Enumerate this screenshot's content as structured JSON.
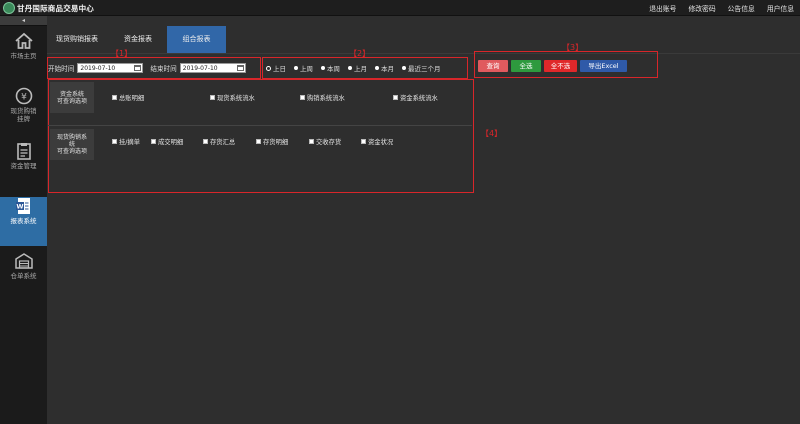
{
  "header": {
    "logo_text": "甘丹国际商品交易中心",
    "links": [
      "退出账号",
      "修改密码",
      "公告信息",
      "用户信息"
    ]
  },
  "sidebar": {
    "collapse_glyph": "◂",
    "items": [
      {
        "label": "市场主页",
        "icon": "home-icon"
      },
      {
        "label": "现货购销",
        "label2": "挂牌",
        "icon": "yen-icon"
      },
      {
        "label": "资金管理",
        "icon": "clipboard-icon"
      },
      {
        "label": "报表系统",
        "icon": "report-icon",
        "active": true
      },
      {
        "label": "仓单系统",
        "icon": "warehouse-icon"
      }
    ]
  },
  "tabs": [
    {
      "label": "现货购销报表"
    },
    {
      "label": "资金报表"
    },
    {
      "label": "组合报表",
      "active": true
    }
  ],
  "filters": {
    "start_label": "开始时间",
    "start_value": "2019-07-10",
    "end_label": "结束时间",
    "end_value": "2019-07-10"
  },
  "ranges": [
    "上日",
    "上周",
    "本周",
    "上月",
    "本月",
    "最近三个月"
  ],
  "buttons": {
    "query": "查询",
    "select_all": "全选",
    "select_none": "全不选",
    "export": "导出Excel"
  },
  "annotations": {
    "a1": "【1】",
    "a2": "【2】",
    "a3": "【3】",
    "a4": "【4】"
  },
  "panel": {
    "fund_head_1": "资金系统",
    "fund_head_2": "可查询选项",
    "fund_options": [
      "总账明细",
      "现货系统流水",
      "购销系统流水",
      "资金系统流水"
    ],
    "spot_head_1": "现货购销系",
    "spot_head_2": "统",
    "spot_head_3": "可查询选项",
    "spot_options": [
      "挂/摘单",
      "成交明细",
      "存货汇总",
      "存货明细",
      "交收存货",
      "资金状况"
    ]
  },
  "colors": {
    "active_blue": "#3167a8",
    "query_btn": "#e05a5e",
    "select_all_btn": "#2e9a3e",
    "select_none_btn": "#e0282a",
    "export_btn": "#2f5aa8",
    "annotation_red": "#d8262a"
  }
}
